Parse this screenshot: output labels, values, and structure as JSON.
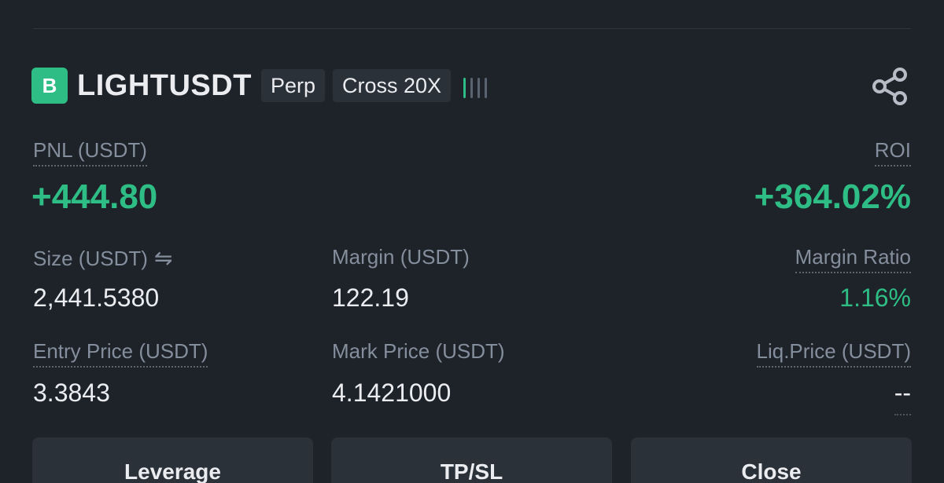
{
  "header": {
    "badge": "B",
    "symbol": "LIGHTUSDT",
    "tags": [
      "Perp",
      "Cross 20X"
    ],
    "risk_level": 1,
    "risk_bars": 4
  },
  "pnl": {
    "label": "PNL (USDT)",
    "value": "+444.80"
  },
  "roi": {
    "label": "ROI",
    "value": "+364.02%"
  },
  "size": {
    "label": "Size (USDT)",
    "value": "2,441.5380",
    "icon": "swap-arrows-icon"
  },
  "margin": {
    "label": "Margin (USDT)",
    "value": "122.19"
  },
  "margin_ratio": {
    "label": "Margin Ratio",
    "value": "1.16%"
  },
  "entry_price": {
    "label": "Entry Price (USDT)",
    "value": "3.3843"
  },
  "mark_price": {
    "label": "Mark Price (USDT)",
    "value": "4.1421000"
  },
  "liq_price": {
    "label": "Liq.Price (USDT)",
    "value": "--"
  },
  "buttons": {
    "leverage": "Leverage",
    "tpsl": "TP/SL",
    "close": "Close"
  },
  "colors": {
    "background": "#1e2329",
    "positive": "#2ebd85",
    "muted": "#848e9c",
    "button": "#2b3139"
  }
}
